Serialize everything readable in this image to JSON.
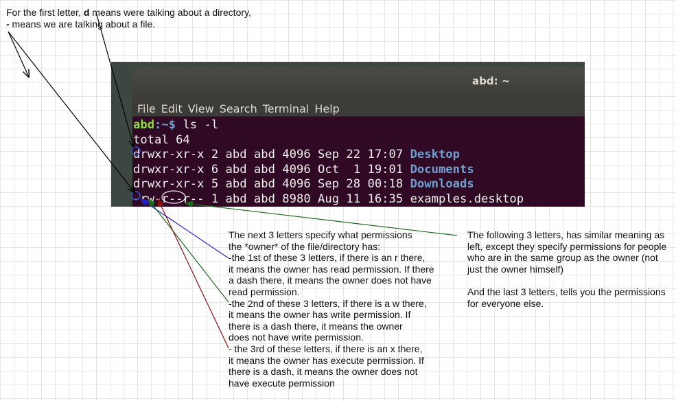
{
  "top_note": {
    "line1_pre": "For the first letter, ",
    "line1_bold": "d",
    "line1_post": " means were talking about a directory,",
    "line2_bold": "-",
    "line2_post": " means we are talking about a file."
  },
  "terminal": {
    "title": "abd: ~",
    "menu": [
      "File",
      "Edit",
      "View",
      "Search",
      "Terminal",
      "Help"
    ],
    "prompt_user": "abd",
    "prompt_path": ":~$",
    "command": " ls -l",
    "total_line": "total 64",
    "rows": [
      {
        "meta": "drwxr-xr-x 2 abd abd 4096 Sep 22 17:07 ",
        "name": "Desktop",
        "is_dir": true
      },
      {
        "meta": "drwxr-xr-x 6 abd abd 4096 Oct  1 19:01 ",
        "name": "Documents",
        "is_dir": true
      },
      {
        "meta": "drwxr-xr-x 5 abd abd 4096 Sep 28 00:18 ",
        "name": "Downloads",
        "is_dir": true
      },
      {
        "meta": "-rw-r--r-- 1 abd abd 8980 Aug 11 16:35 ",
        "name": "examples.desktop",
        "is_dir": false
      }
    ]
  },
  "owner_note": {
    "text": "The next 3 letters specify what permissions\nthe *owner* of the file/directory has:\n-the 1st of these 3 letters, if there is an r there,\nit means the owner has read permission. If there\na dash there, it means the owner does not have\nread permission.\n-the 2nd of these 3 letters, if there is a w there,\nit means the owner has write permission. If\nthere is a dash there, it means the owner\ndoes not have write permission.\n- the 3rd of these letters, if there is an x there,\nit means the owner has execute permission. If\nthere is a dash, it means the owner does not\nhave execute permission"
  },
  "group_note": {
    "text": "The following 3 letters, has similar meaning as\nleft, except they specify permissions for people\nwho are in the same group as the owner (not\njust the owner himself)\n\nAnd the last 3 letters, tells you the permissions\nfor everyone else."
  },
  "colors": {
    "black_arrow": "#000000",
    "blue_arrow": "#2222cc",
    "green_arrow": "#1a6b1a",
    "red_arrow": "#8b1010",
    "highlight_circle": "#3355cc",
    "group_ellipse": "#e8e8e8"
  }
}
